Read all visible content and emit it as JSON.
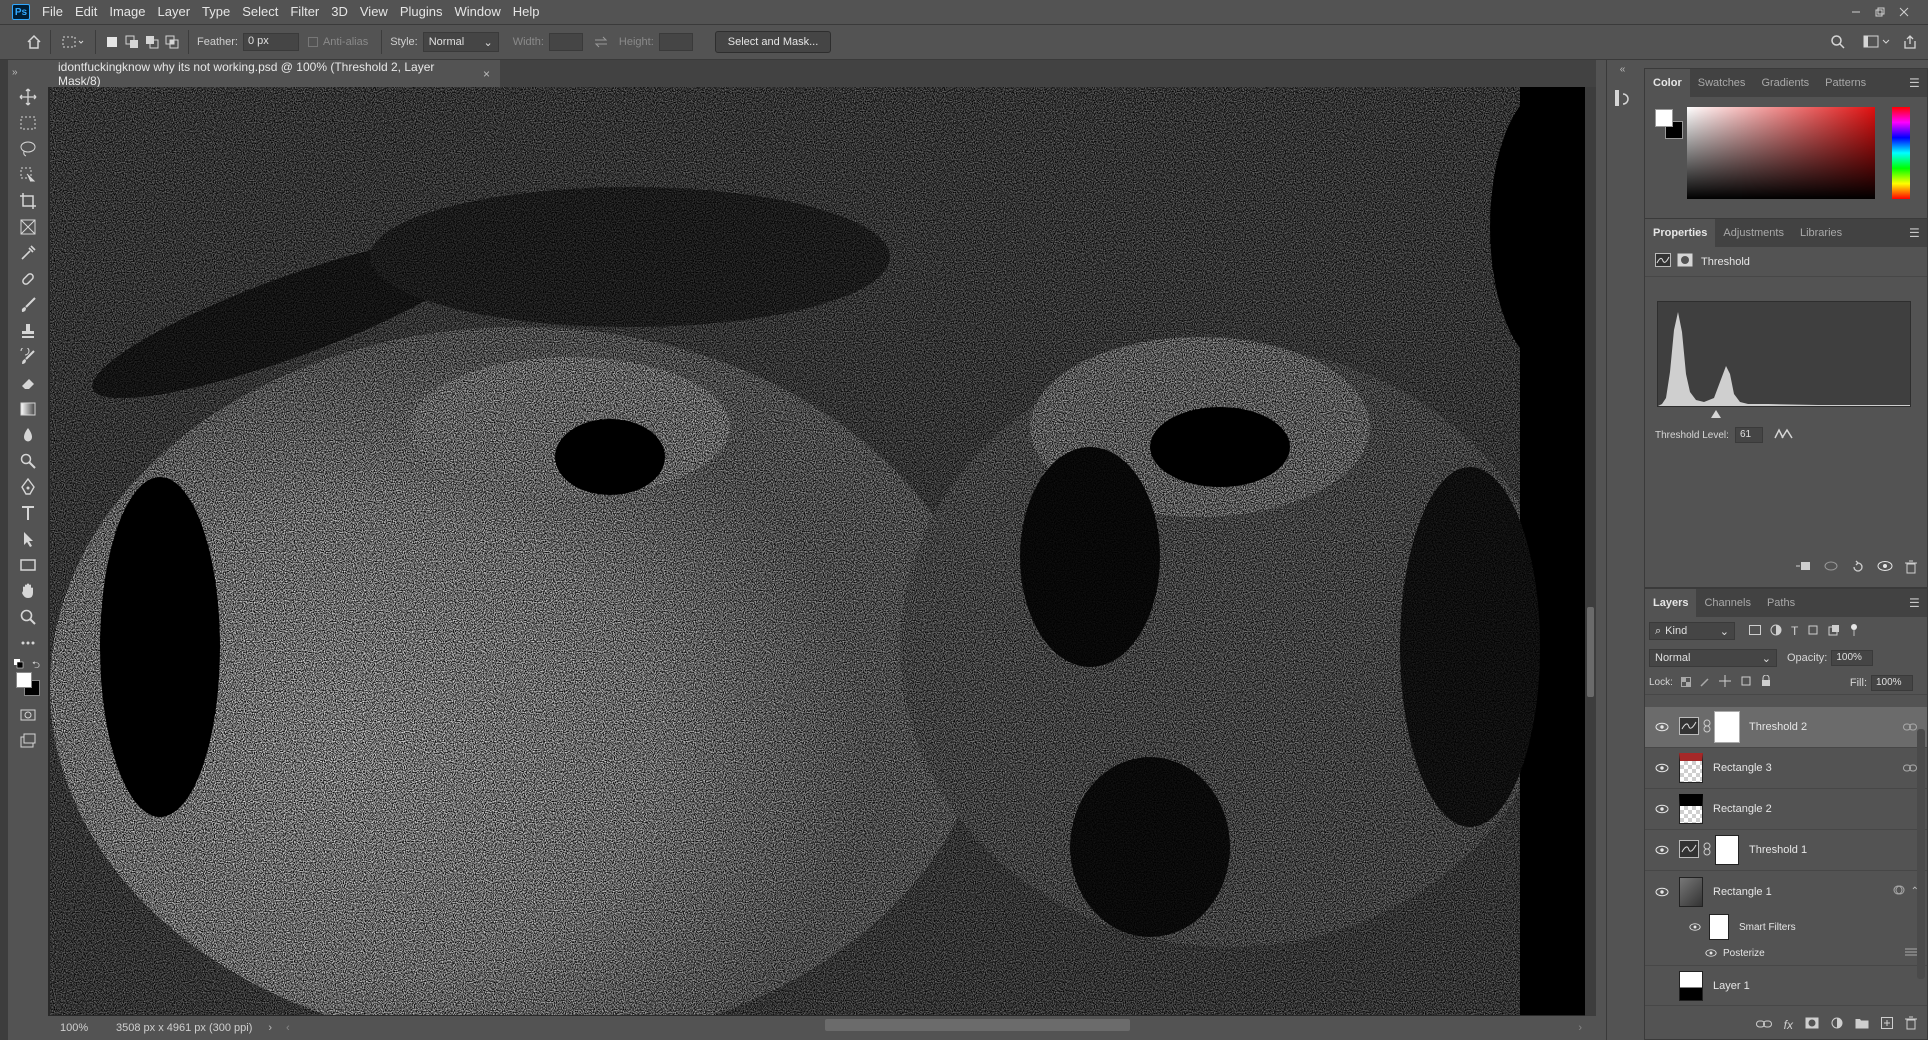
{
  "menubar": {
    "app_icon": "Ps",
    "items": [
      "File",
      "Edit",
      "Image",
      "Layer",
      "Type",
      "Select",
      "Filter",
      "3D",
      "View",
      "Plugins",
      "Window",
      "Help"
    ],
    "window_controls": [
      "minimize-icon",
      "restore-icon",
      "close-icon"
    ]
  },
  "options": {
    "feather_label": "Feather:",
    "feather_value": "0 px",
    "antialias_label": "Anti-alias",
    "style_label": "Style:",
    "style_value": "Normal",
    "width_label": "Width:",
    "height_label": "Height:",
    "select_mask_label": "Select and Mask..."
  },
  "document": {
    "tab_title": "idontfuckingknow why its not working.psd @ 100% (Threshold 2, Layer Mask/8)",
    "close_glyph": "×",
    "zoom": "100%",
    "doc_info": "3508 px x 4961 px (300 ppi)"
  },
  "color_panel": {
    "tabs": [
      "Color",
      "Swatches",
      "Gradients",
      "Patterns"
    ],
    "active_tab": "Color",
    "foreground": "#ffffff",
    "background": "#000000"
  },
  "properties_panel": {
    "tabs": [
      "Properties",
      "Adjustments",
      "Libraries"
    ],
    "active_tab": "Properties",
    "adjustment_name": "Threshold",
    "threshold_label": "Threshold Level:",
    "threshold_value": "61"
  },
  "layers_panel": {
    "tabs": [
      "Layers",
      "Channels",
      "Paths"
    ],
    "active_tab": "Layers",
    "filter_kind": "Kind",
    "blend_mode": "Normal",
    "opacity_label": "Opacity:",
    "opacity_value": "100%",
    "lock_label": "Lock:",
    "fill_label": "Fill:",
    "fill_value": "100%",
    "layers": [
      {
        "name": "Threshold 2",
        "selected": true
      },
      {
        "name": "Rectangle 3",
        "selected": false
      },
      {
        "name": "Rectangle 2",
        "selected": false
      },
      {
        "name": "Threshold 1",
        "selected": false
      },
      {
        "name": "Rectangle 1",
        "selected": false
      }
    ],
    "smart_filters_label": "Smart Filters",
    "posterize_label": "Posterize",
    "layer1_name": "Layer 1"
  },
  "accent": "#31a8ff",
  "selection_color": "#6b6b6b"
}
